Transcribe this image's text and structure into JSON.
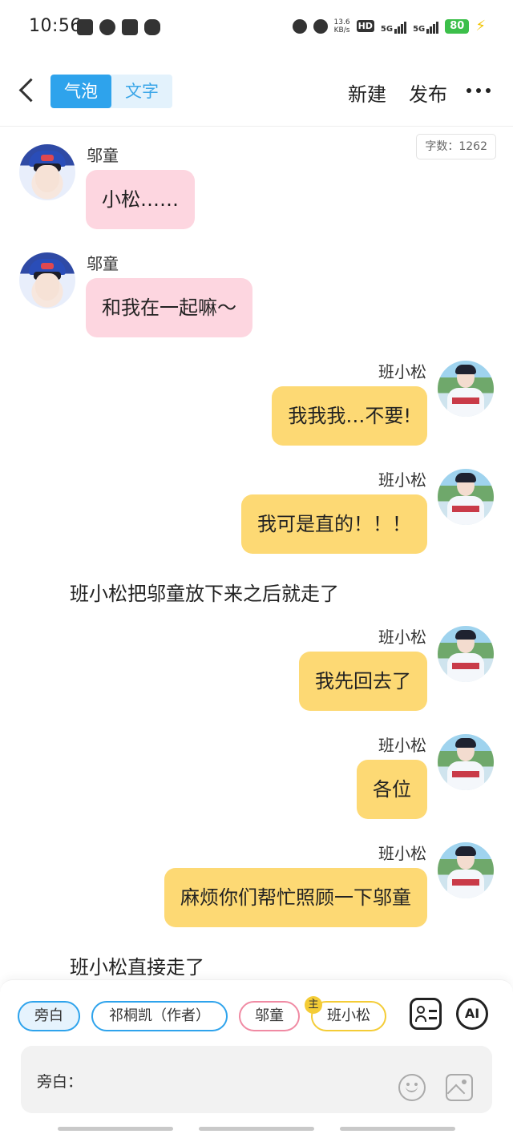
{
  "status_bar": {
    "time": "10:56",
    "net_speed": "13.6",
    "net_unit": "KB/s",
    "hd_label": "HD",
    "net1": "5G",
    "net2": "5G",
    "battery": "80"
  },
  "header": {
    "tabs": [
      {
        "label": "气泡",
        "active": true
      },
      {
        "label": "文字",
        "active": false
      }
    ],
    "new_label": "新建",
    "publish_label": "发布"
  },
  "word_count": "字数：1262",
  "messages": [
    {
      "type": "left",
      "name": "邬童",
      "text": "小松……"
    },
    {
      "type": "left",
      "name": "邬童",
      "text": "和我在一起嘛～"
    },
    {
      "type": "right",
      "name": "班小松",
      "text": "我我我…不要!"
    },
    {
      "type": "right",
      "name": "班小松",
      "text": "我可是直的！！！"
    },
    {
      "type": "narration",
      "text": "班小松把邬童放下来之后就走了"
    },
    {
      "type": "right",
      "name": "班小松",
      "text": "我先回去了"
    },
    {
      "type": "right",
      "name": "班小松",
      "text": "各位"
    },
    {
      "type": "right",
      "name": "班小松",
      "text": "麻烦你们帮忙照顾一下邬童"
    },
    {
      "type": "narration",
      "text": "班小松直接走了"
    }
  ],
  "bottom": {
    "roles": [
      {
        "label": "旁白",
        "selected": true
      },
      {
        "label": "祁桐凯（作者）"
      },
      {
        "label": "邬童"
      },
      {
        "label": "班小松"
      }
    ],
    "main_badge": "主",
    "ai_label": "AI",
    "input_label": "旁白："
  },
  "colors": {
    "accent": "#2ea3ec",
    "bubble_left": "#fdd6e0",
    "bubble_right": "#fdd974",
    "chip_wu": "#f08aa3",
    "chip_ban": "#f4cc36"
  },
  "icons": [
    "back-icon",
    "more-icon",
    "role-card-icon",
    "ai-icon",
    "emoji-icon",
    "image-icon"
  ]
}
